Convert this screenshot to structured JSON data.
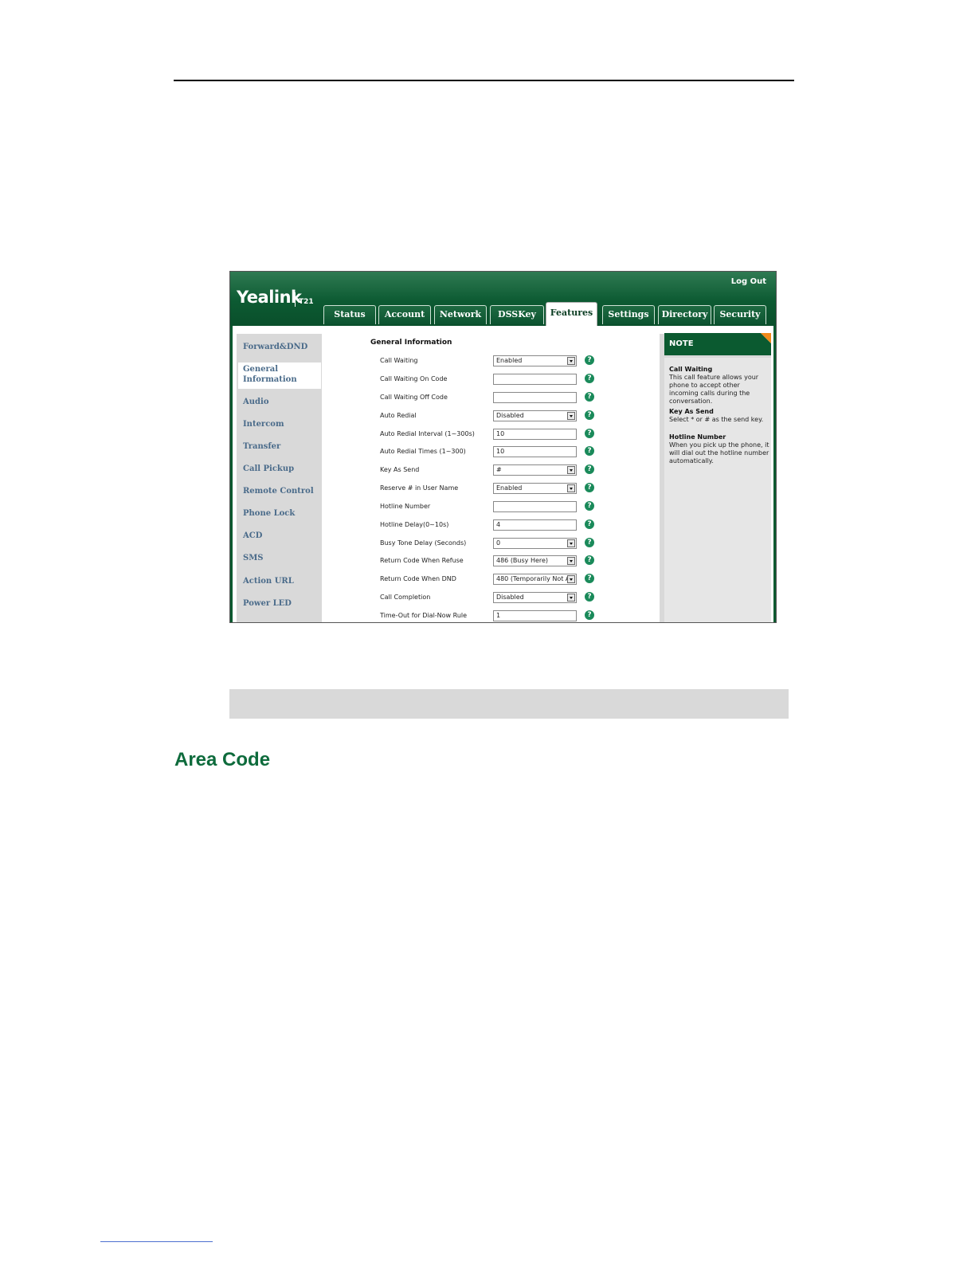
{
  "app": {
    "logout_label": "Log Out",
    "logo_text": "Yealink",
    "model": "T21"
  },
  "tabs": [
    {
      "label": "Status",
      "active": false
    },
    {
      "label": "Account",
      "active": false
    },
    {
      "label": "Network",
      "active": false
    },
    {
      "label": "DSSKey",
      "active": false
    },
    {
      "label": "Features",
      "active": true
    },
    {
      "label": "Settings",
      "active": false
    },
    {
      "label": "Directory",
      "active": false
    },
    {
      "label": "Security",
      "active": false
    }
  ],
  "sidebar": {
    "items": [
      {
        "label": "Forward&DND"
      },
      {
        "label": "General Information",
        "active": true
      },
      {
        "label": "Audio"
      },
      {
        "label": "Intercom"
      },
      {
        "label": "Transfer"
      },
      {
        "label": "Call Pickup"
      },
      {
        "label": "Remote Control"
      },
      {
        "label": "Phone Lock"
      },
      {
        "label": "ACD"
      },
      {
        "label": "SMS"
      },
      {
        "label": "Action URL"
      },
      {
        "label": "Power LED"
      }
    ]
  },
  "form": {
    "section_title": "General Information",
    "rows": [
      {
        "label": "Call Waiting",
        "type": "select",
        "value": "Enabled"
      },
      {
        "label": "Call Waiting On Code",
        "type": "text",
        "value": ""
      },
      {
        "label": "Call Waiting Off Code",
        "type": "text",
        "value": ""
      },
      {
        "label": "Auto Redial",
        "type": "select",
        "value": "Disabled"
      },
      {
        "label": "Auto Redial Interval (1~300s)",
        "type": "text",
        "value": "10"
      },
      {
        "label": "Auto Redial Times (1~300)",
        "type": "text",
        "value": "10"
      },
      {
        "label": "Key As Send",
        "type": "select",
        "value": "#"
      },
      {
        "label": "Reserve # in User Name",
        "type": "select",
        "value": "Enabled"
      },
      {
        "label": "Hotline Number",
        "type": "text",
        "value": ""
      },
      {
        "label": "Hotline Delay(0~10s)",
        "type": "text",
        "value": "4"
      },
      {
        "label": "Busy Tone Delay (Seconds)",
        "type": "select",
        "value": "0"
      },
      {
        "label": "Return Code When Refuse",
        "type": "select",
        "value": "486 (Busy Here)"
      },
      {
        "label": "Return Code When DND",
        "type": "select",
        "value": "480 (Temporarily Not Av"
      },
      {
        "label": "Call Completion",
        "type": "select",
        "value": "Disabled"
      },
      {
        "label": "Time-Out for Dial-Now Rule",
        "type": "text",
        "value": "1"
      }
    ]
  },
  "note": {
    "title": "NOTE",
    "entries": [
      {
        "title": "Call Waiting",
        "text": "This call feature allows your phone to accept other incoming calls during the conversation."
      },
      {
        "title": "Key As Send",
        "text": "Select * or # as the send key."
      },
      {
        "title": "Hotline Number",
        "text": "When you pick up the phone, it will dial out the hotline number automatically."
      }
    ]
  },
  "page": {
    "heading": "Area Code"
  },
  "colors": {
    "brand_green": "#0b5a30",
    "heading_green": "#0e6b3c",
    "nav_text": "#4a6b8a",
    "note_accent": "#f08a1a"
  }
}
